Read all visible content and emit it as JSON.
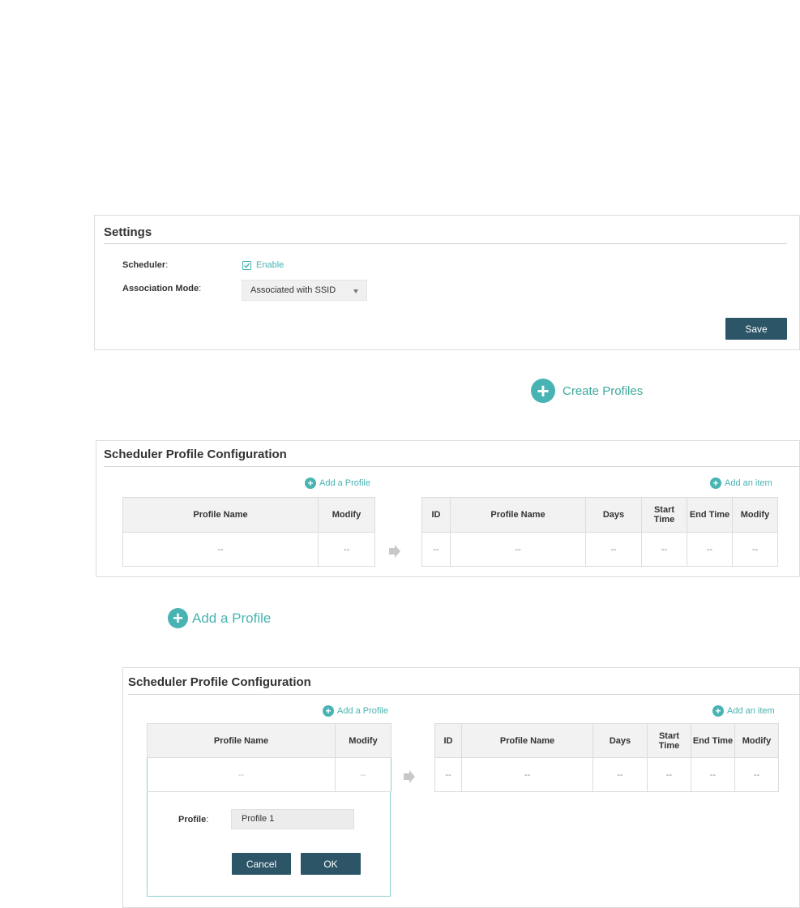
{
  "settings": {
    "title": "Settings",
    "scheduler_label": "Scheduler",
    "scheduler_enable": "Enable",
    "scheduler_checked": true,
    "association_label": "Association Mode",
    "association_value": "Associated with SSID",
    "save_label": "Save"
  },
  "create_profiles": {
    "label": "Create Profiles"
  },
  "config1": {
    "title": "Scheduler Profile Configuration",
    "add_profile": "Add a Profile",
    "add_item": "Add an item",
    "left_headers": [
      "Profile Name",
      "Modify"
    ],
    "left_row": [
      "--",
      "--"
    ],
    "right_headers": [
      "ID",
      "Profile Name",
      "Days",
      "Start Time",
      "End Time",
      "Modify"
    ],
    "right_row": [
      "--",
      "--",
      "--",
      "--",
      "--",
      "--"
    ]
  },
  "add_profile_callout": {
    "label": "Add a Profile"
  },
  "config2": {
    "title": "Scheduler Profile Configuration",
    "add_profile": "Add a Profile",
    "add_item": "Add an item",
    "left_headers": [
      "Profile Name",
      "Modify"
    ],
    "left_row": [
      "--",
      "--"
    ],
    "right_headers": [
      "ID",
      "Profile Name",
      "Days",
      "Start Time",
      "End Time",
      "Modify"
    ],
    "right_row": [
      "--",
      "--",
      "--",
      "--",
      "--",
      "--"
    ],
    "profile_label": "Profile",
    "profile_value": "Profile 1",
    "cancel_label": "Cancel",
    "ok_label": "OK"
  },
  "colors": {
    "accent": "#48b3b3",
    "button": "#2c5568",
    "border": "#dcdcdc",
    "header_bg": "#f2f2f2"
  }
}
